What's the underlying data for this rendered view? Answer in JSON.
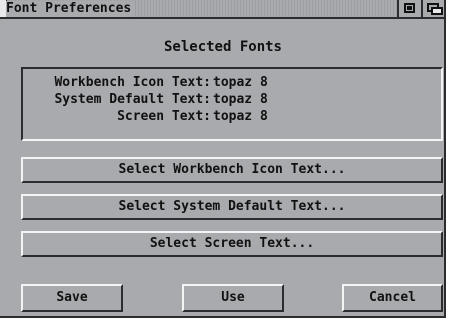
{
  "window": {
    "title": "Font Preferences"
  },
  "icons": {
    "close": "close-gadget",
    "zoom": "zoom-gadget-icon",
    "depth": "depth-gadget-icon"
  },
  "selected_fonts": {
    "heading": "Selected Fonts",
    "lines": [
      {
        "label": "Workbench Icon Text:",
        "value": "topaz 8"
      },
      {
        "label": "System Default Text:",
        "value": "topaz 8"
      },
      {
        "label": "Screen Text:",
        "value": "topaz 8"
      }
    ]
  },
  "select_buttons": {
    "workbench": "Select Workbench Icon Text...",
    "system": "Select System Default Text...",
    "screen": "Select Screen Text..."
  },
  "actions": {
    "save": "Save",
    "use": "Use",
    "cancel": "Cancel"
  },
  "colors": {
    "window_bg": "#a9aaad",
    "shadow": "#2c2c2e",
    "shine": "#f4f4f5",
    "text": "#111111"
  }
}
